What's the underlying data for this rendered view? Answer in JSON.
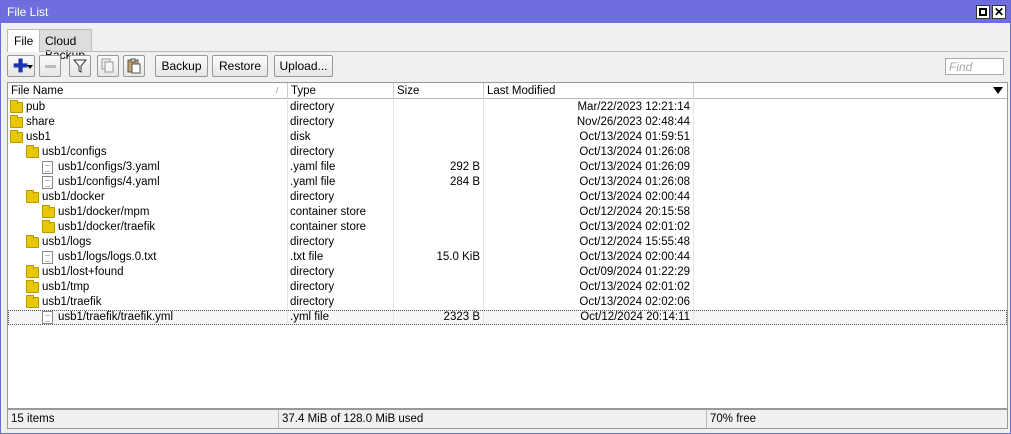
{
  "window": {
    "title": "File List"
  },
  "tabs": [
    {
      "label": "File"
    },
    {
      "label": "Cloud Backup"
    }
  ],
  "toolbar": {
    "backup_label": "Backup",
    "restore_label": "Restore",
    "upload_label": "Upload...",
    "find_placeholder": "Find"
  },
  "columns": {
    "name": "File Name",
    "type": "Type",
    "size": "Size",
    "modified": "Last Modified"
  },
  "rows": [
    {
      "name": "pub",
      "type": "directory",
      "size": "",
      "modified": "Mar/22/2023 12:21:14",
      "icon": "folder-icon",
      "depth": 0
    },
    {
      "name": "share",
      "type": "directory",
      "size": "",
      "modified": "Nov/26/2023 02:48:44",
      "icon": "folder-icon",
      "depth": 0
    },
    {
      "name": "usb1",
      "type": "disk",
      "size": "",
      "modified": "Oct/13/2024 01:59:51",
      "icon": "folder-icon",
      "depth": 0
    },
    {
      "name": "usb1/configs",
      "type": "directory",
      "size": "",
      "modified": "Oct/13/2024 01:26:08",
      "icon": "folder-icon",
      "depth": 1
    },
    {
      "name": "usb1/configs/3.yaml",
      "type": ".yaml file",
      "size": "292 B",
      "modified": "Oct/13/2024 01:26:09",
      "icon": "file-icon",
      "depth": 2
    },
    {
      "name": "usb1/configs/4.yaml",
      "type": ".yaml file",
      "size": "284 B",
      "modified": "Oct/13/2024 01:26:08",
      "icon": "file-icon",
      "depth": 2
    },
    {
      "name": "usb1/docker",
      "type": "directory",
      "size": "",
      "modified": "Oct/13/2024 02:00:44",
      "icon": "folder-icon",
      "depth": 1
    },
    {
      "name": "usb1/docker/mpm",
      "type": "container store",
      "size": "",
      "modified": "Oct/12/2024 20:15:58",
      "icon": "folder-icon",
      "depth": 2
    },
    {
      "name": "usb1/docker/traefik",
      "type": "container store",
      "size": "",
      "modified": "Oct/13/2024 02:01:02",
      "icon": "folder-icon",
      "depth": 2
    },
    {
      "name": "usb1/logs",
      "type": "directory",
      "size": "",
      "modified": "Oct/12/2024 15:55:48",
      "icon": "folder-icon",
      "depth": 1
    },
    {
      "name": "usb1/logs/logs.0.txt",
      "type": ".txt file",
      "size": "15.0 KiB",
      "modified": "Oct/13/2024 02:00:44",
      "icon": "file-icon",
      "depth": 2
    },
    {
      "name": "usb1/lost+found",
      "type": "directory",
      "size": "",
      "modified": "Oct/09/2024 01:22:29",
      "icon": "folder-icon",
      "depth": 1
    },
    {
      "name": "usb1/tmp",
      "type": "directory",
      "size": "",
      "modified": "Oct/13/2024 02:01:02",
      "icon": "folder-icon",
      "depth": 1
    },
    {
      "name": "usb1/traefik",
      "type": "directory",
      "size": "",
      "modified": "Oct/13/2024 02:02:06",
      "icon": "folder-icon",
      "depth": 1
    },
    {
      "name": "usb1/traefik/traefik.yml",
      "type": ".yml file",
      "size": "2323 B",
      "modified": "Oct/12/2024 20:14:11",
      "icon": "file-icon",
      "depth": 2,
      "selected": true
    }
  ],
  "status": {
    "items": "15 items",
    "usage": "37.4 MiB of 128.0 MiB used",
    "free": "70% free"
  }
}
